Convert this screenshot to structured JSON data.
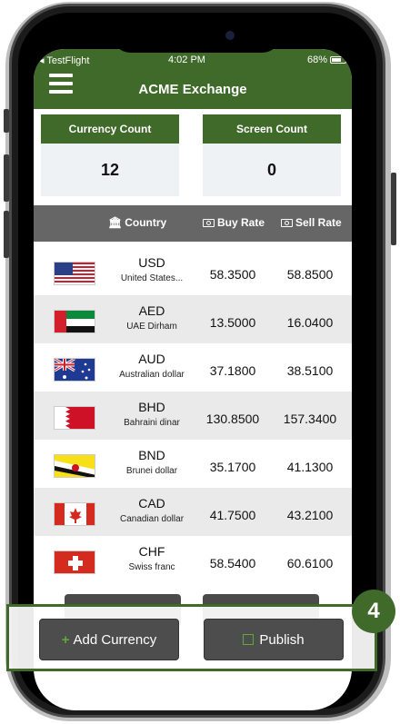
{
  "status_bar": {
    "carrier": "◂ TestFlight",
    "time": "4:02 PM",
    "battery": "68%"
  },
  "app": {
    "title": "ACME Exchange"
  },
  "stats": {
    "currency_count_label": "Currency Count",
    "currency_count_value": "12",
    "screen_count_label": "Screen Count",
    "screen_count_value": "0"
  },
  "table": {
    "headers": {
      "country": "Country",
      "buy": "Buy Rate",
      "sell": "Sell Rate"
    },
    "rows": [
      {
        "code": "USD",
        "name": "United States...",
        "buy": "58.3500",
        "sell": "58.8500",
        "flag": "us"
      },
      {
        "code": "AED",
        "name": "UAE Dirham",
        "buy": "13.5000",
        "sell": "16.0400",
        "flag": "ae"
      },
      {
        "code": "AUD",
        "name": "Australian dollar",
        "buy": "37.1800",
        "sell": "38.5100",
        "flag": "au"
      },
      {
        "code": "BHD",
        "name": "Bahraini dinar",
        "buy": "130.8500",
        "sell": "157.3400",
        "flag": "bh"
      },
      {
        "code": "BND",
        "name": "Brunei dollar",
        "buy": "35.1700",
        "sell": "41.1300",
        "flag": "bn"
      },
      {
        "code": "CAD",
        "name": "Canadian dollar",
        "buy": "41.7500",
        "sell": "43.2100",
        "flag": "ca"
      },
      {
        "code": "CHF",
        "name": "Swiss franc",
        "buy": "58.5400",
        "sell": "60.6100",
        "flag": "ch"
      }
    ]
  },
  "actions": {
    "add_currency": "Add Currency",
    "publish": "Publish"
  },
  "callout": {
    "step": "4"
  },
  "colors": {
    "brand_green": "#3f6a2a",
    "header_gray": "#666666",
    "button_dark": "#4d4d4d"
  }
}
